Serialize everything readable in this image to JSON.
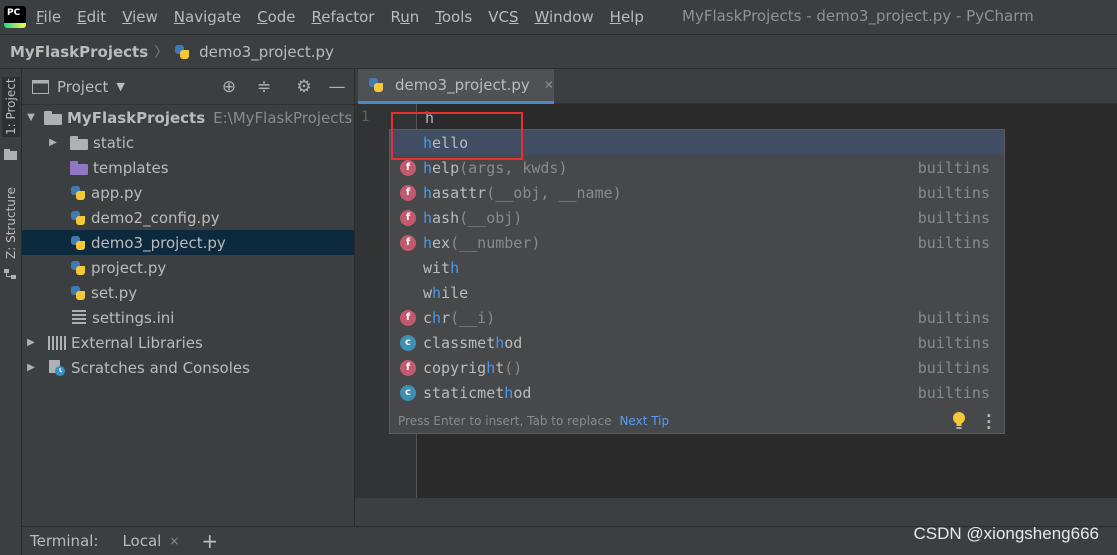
{
  "menubar": {
    "items": [
      {
        "pre": "",
        "u": "F",
        "post": "ile"
      },
      {
        "pre": "",
        "u": "E",
        "post": "dit"
      },
      {
        "pre": "",
        "u": "V",
        "post": "iew"
      },
      {
        "pre": "",
        "u": "N",
        "post": "avigate"
      },
      {
        "pre": "",
        "u": "C",
        "post": "ode"
      },
      {
        "pre": "",
        "u": "R",
        "post": "efactor"
      },
      {
        "pre": "R",
        "u": "u",
        "post": "n"
      },
      {
        "pre": "",
        "u": "T",
        "post": "ools"
      },
      {
        "pre": "VC",
        "u": "S",
        "post": ""
      },
      {
        "pre": "",
        "u": "W",
        "post": "indow"
      },
      {
        "pre": "",
        "u": "H",
        "post": "elp"
      }
    ],
    "window_title": "MyFlaskProjects - demo3_project.py - PyCharm"
  },
  "breadcrumb": {
    "project": "MyFlaskProjects",
    "file": "demo3_project.py"
  },
  "left_strip": {
    "project_tab": "1: Project",
    "structure_tab": "Z: Structure"
  },
  "project_panel": {
    "title": "Project",
    "tree": {
      "root": {
        "name": "MyFlaskProjects",
        "path": "E:\\MyFlaskProjects"
      },
      "static": "static",
      "templates": "templates",
      "files": [
        "app.py",
        "demo2_config.py",
        "demo3_project.py",
        "project.py",
        "set.py"
      ],
      "settings": "settings.ini",
      "external": "External Libraries",
      "scratches": "Scratches and Consoles"
    }
  },
  "editor": {
    "tab_label": "demo3_project.py",
    "line_number": "1",
    "code": "h"
  },
  "completion": {
    "items": [
      {
        "badge": "",
        "pre": "",
        "m": "h",
        "rest": "ello",
        "args": "",
        "type": ""
      },
      {
        "badge": "f",
        "pre": "",
        "m": "h",
        "rest": "elp",
        "args": "(args, kwds)",
        "type": "builtins"
      },
      {
        "badge": "f",
        "pre": "",
        "m": "h",
        "rest": "asattr",
        "args": "(__obj, __name)",
        "type": "builtins"
      },
      {
        "badge": "f",
        "pre": "",
        "m": "h",
        "rest": "ash",
        "args": "(__obj)",
        "type": "builtins"
      },
      {
        "badge": "f",
        "pre": "",
        "m": "h",
        "rest": "ex",
        "args": "(__number)",
        "type": "builtins"
      },
      {
        "badge": "",
        "pre": "wit",
        "m": "h",
        "rest": "",
        "args": "",
        "type": ""
      },
      {
        "badge": "",
        "pre": "w",
        "m": "h",
        "rest": "ile",
        "args": "",
        "type": ""
      },
      {
        "badge": "f",
        "pre": "c",
        "m": "h",
        "rest": "r",
        "args": "(__i)",
        "type": "builtins"
      },
      {
        "badge": "c",
        "pre": "classmet",
        "m": "h",
        "rest": "od",
        "args": "",
        "type": "builtins"
      },
      {
        "badge": "f",
        "pre": "copyrig",
        "m": "h",
        "rest": "t",
        "args": "()",
        "type": "builtins"
      },
      {
        "badge": "c",
        "pre": "staticmet",
        "m": "h",
        "rest": "od",
        "args": "",
        "type": "builtins"
      }
    ],
    "footer_hint": "Press Enter to insert, Tab to replace",
    "next_tip": "Next Tip"
  },
  "terminal": {
    "label": "Terminal:",
    "local_tab": "Local",
    "close": "×",
    "add": "+"
  },
  "watermark": "CSDN @xiongsheng666"
}
